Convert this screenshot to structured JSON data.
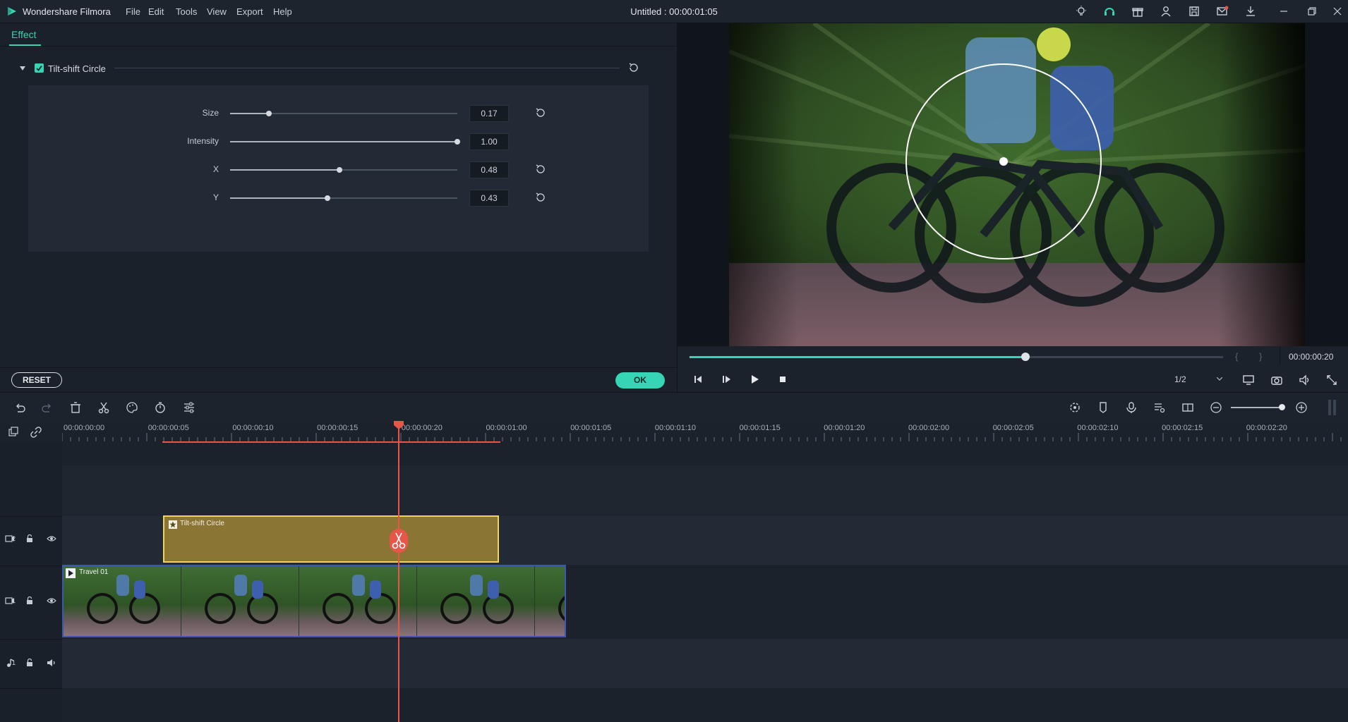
{
  "app": {
    "name": "Wondershare Filmora",
    "document_title": "Untitled : 00:00:01:05",
    "menu": [
      "File",
      "Edit",
      "Tools",
      "View",
      "Export",
      "Help"
    ]
  },
  "effect_panel": {
    "tab_label": "Effect",
    "effect_name": "Tilt-shift Circle",
    "effect_enabled": true,
    "params": [
      {
        "label": "Size",
        "value": "0.17",
        "slider": 0.17
      },
      {
        "label": "Intensity",
        "value": "1.00",
        "slider": 1.0
      },
      {
        "label": "X",
        "value": "0.48",
        "slider": 0.48
      },
      {
        "label": "Y",
        "value": "0.43",
        "slider": 0.43
      }
    ],
    "reset_label": "RESET",
    "ok_label": "OK"
  },
  "preview": {
    "progress": 0.63,
    "timecode": "00:00:00:20",
    "quality": "1/2"
  },
  "timeline": {
    "ruler_labels": [
      "00:00:00:00",
      "00:00:00:05",
      "00:00:00:10",
      "00:00:00:15",
      "00:00:00:20",
      "00:00:01:00",
      "00:00:01:05",
      "00:00:01:10",
      "00:00:01:15",
      "00:00:01:20",
      "00:00:02:00",
      "00:00:02:05",
      "00:00:02:10",
      "00:00:02:15",
      "00:00:02:20"
    ],
    "tracks": [
      {
        "id": "2",
        "kind": "video"
      },
      {
        "id": "1",
        "kind": "video"
      },
      {
        "id": "1",
        "kind": "audio"
      }
    ],
    "effect_clip_label": "Tilt-shift Circle",
    "video_clip_label": "Travel 01"
  },
  "colors": {
    "accent": "#35d5b5",
    "playhead": "#e8564a",
    "effect_clip": "#8b7535",
    "effect_clip_border": "#f2d45c",
    "video_clip_border": "#3b57b0"
  }
}
